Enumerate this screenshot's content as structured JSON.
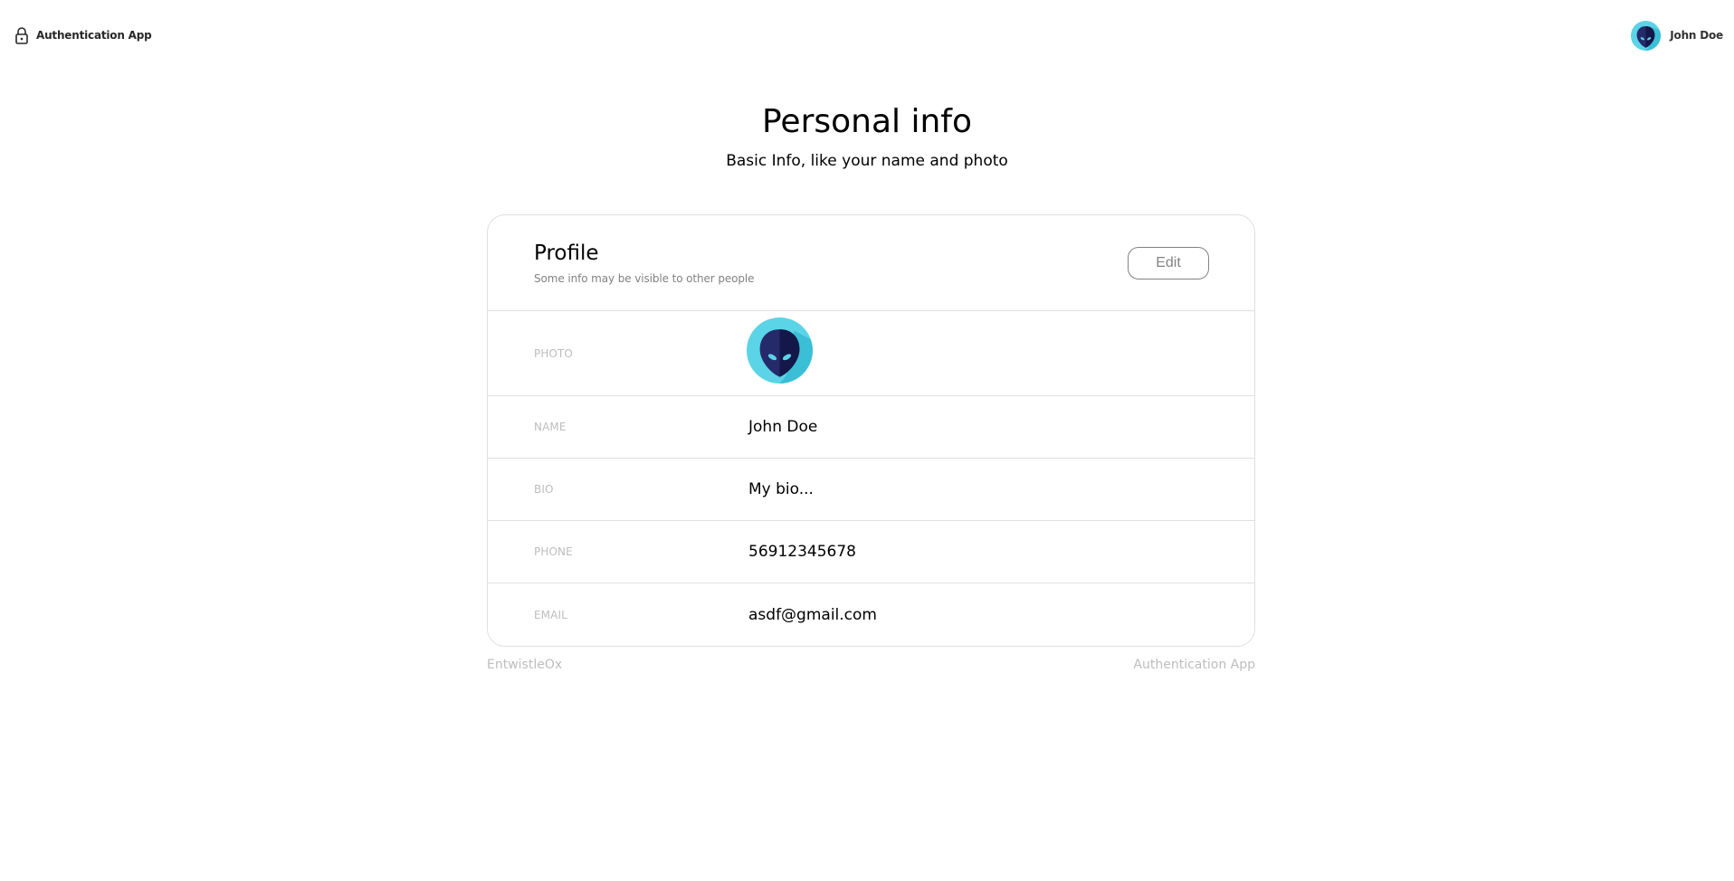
{
  "app": {
    "brand_name": "Authentication App",
    "brand_icon": "lock-icon"
  },
  "user_menu": {
    "name": "John Doe",
    "avatar_icon": "alien-avatar-icon"
  },
  "header": {
    "title": "Personal info",
    "subtitle": "Basic Info, like your name and photo"
  },
  "profile_card": {
    "title": "Profile",
    "subtitle": "Some info may be visible to other people",
    "edit_label": "Edit",
    "rows": [
      {
        "label": "PHOTO",
        "value": ""
      },
      {
        "label": "NAME",
        "value": "John Doe"
      },
      {
        "label": "BIO",
        "value": "My bio..."
      },
      {
        "label": "PHONE",
        "value": "56912345678"
      },
      {
        "label": "EMAIL",
        "value": "asdf@gmail.com"
      }
    ]
  },
  "footer": {
    "left": "EntwistleOx",
    "right": "Authentication App"
  },
  "colors": {
    "avatar_bg": "#5ad4e6",
    "avatar_head_dark": "#1b1f5c",
    "avatar_eyes": "#5ad4e6",
    "border": "#e0e0e0",
    "muted_text": "#828282",
    "label_text": "#bdbdbd"
  }
}
